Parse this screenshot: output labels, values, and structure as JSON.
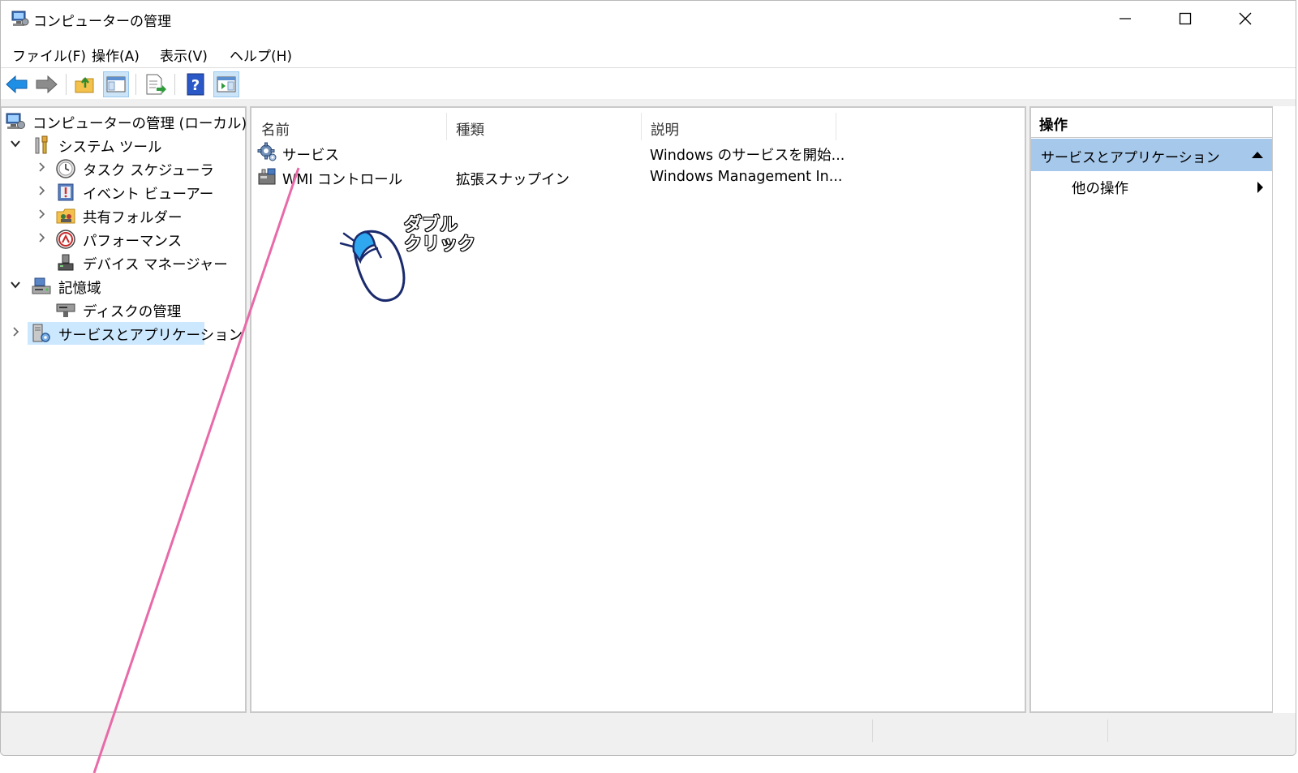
{
  "window": {
    "title": "コンピューターの管理",
    "controls": {
      "minimize": "minimize-icon",
      "maximize": "maximize-icon",
      "close": "close-icon"
    }
  },
  "menu": [
    "ファイル(F)",
    "操作(A)",
    "表示(V)",
    "ヘルプ(H)"
  ],
  "toolbar": [
    "back-arrow-icon",
    "forward-arrow-icon",
    "up-folder-icon",
    "show-hide-console-tree-icon",
    "export-list-icon",
    "help-icon",
    "show-hide-action-pane-icon"
  ],
  "tree": {
    "root": "コンピューターの管理 (ローカル)",
    "system_tools": "システム ツール",
    "task_scheduler": "タスク スケジューラ",
    "event_viewer": "イベント ビューアー",
    "shared_folders": "共有フォルダー",
    "performance": "パフォーマンス",
    "device_manager": "デバイス マネージャー",
    "storage": "記憶域",
    "disk_management": "ディスクの管理",
    "services_apps": "サービスとアプリケーション"
  },
  "list": {
    "columns": [
      "名前",
      "種類",
      "説明"
    ],
    "rows": [
      {
        "name": "サービス",
        "type": "",
        "desc": "Windows のサービスを開始..."
      },
      {
        "name": "WMI コントロール",
        "type": "拡張スナップイン",
        "desc": "Windows Management In..."
      }
    ]
  },
  "actions": {
    "header": "操作",
    "section": "サービスとアプリケーション",
    "more": "他の操作"
  },
  "annotation": {
    "line1": "ダブル",
    "line2": "クリック",
    "color": "#e86aa8"
  }
}
